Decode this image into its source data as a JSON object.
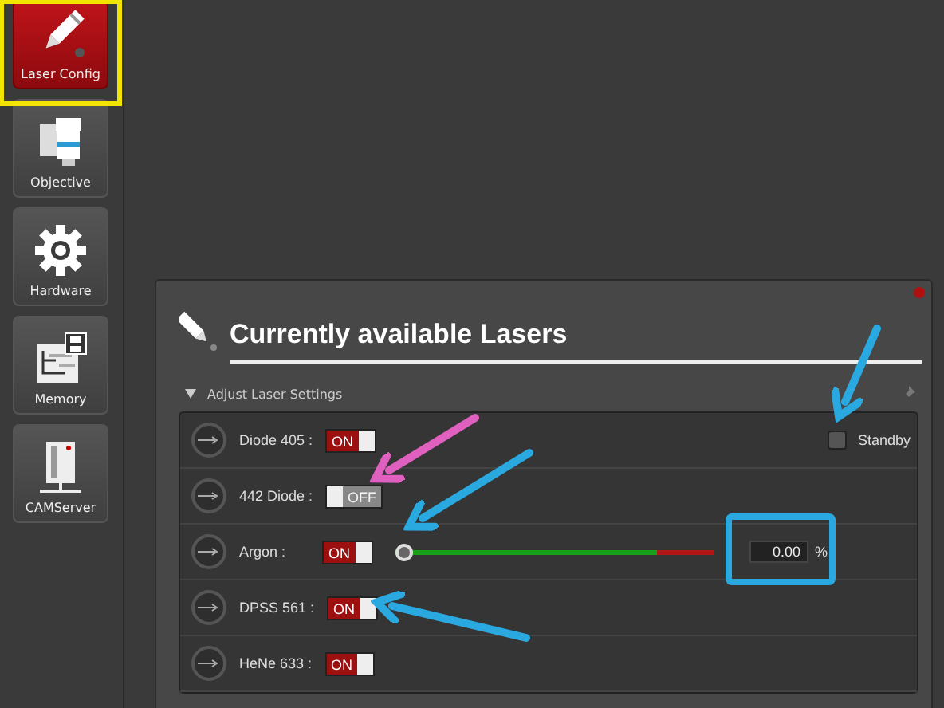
{
  "nav": [
    {
      "label": "Laser Config",
      "selected": true
    },
    {
      "label": "Objective",
      "selected": false
    },
    {
      "label": "Hardware",
      "selected": false
    },
    {
      "label": "Memory",
      "selected": false
    },
    {
      "label": "CAMServer",
      "selected": false
    }
  ],
  "panel": {
    "title": "Currently available Lasers",
    "section": {
      "label": "Adjust Laser Settings",
      "expanded": true
    },
    "standby": {
      "label": "Standby",
      "checked": false
    },
    "lasers": [
      {
        "name": "Diode 405 :",
        "kind": "toggle",
        "on": true,
        "on_label": "ON"
      },
      {
        "name": "442 Diode :",
        "kind": "toggle",
        "on": false,
        "off_label": "OFF"
      },
      {
        "name": "Argon :",
        "kind": "slider",
        "on": true,
        "on_label": "ON",
        "level": 0,
        "value": "0.00",
        "unit": "%"
      },
      {
        "name": "DPSS 561 :",
        "kind": "toggle",
        "on": true,
        "on_label": "ON"
      },
      {
        "name": "HeNe 633 :",
        "kind": "toggle",
        "on": true,
        "on_label": "ON"
      }
    ]
  }
}
